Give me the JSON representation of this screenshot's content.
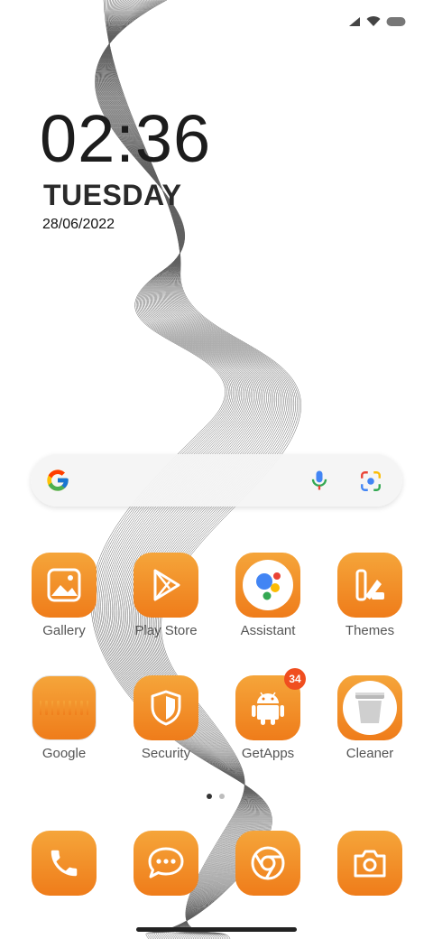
{
  "lockscreen": {
    "time": "02:36",
    "day": "TUESDAY",
    "date": "28/06/2022"
  },
  "status_bar": {
    "icons": [
      "signal-icon",
      "wifi-icon",
      "battery-icon"
    ]
  },
  "search_widget": {
    "icons": [
      "google-logo-icon",
      "microphone-icon",
      "google-lens-icon"
    ]
  },
  "apps_row1": [
    {
      "label": "Gallery",
      "icon": "gallery-icon"
    },
    {
      "label": "Play Store",
      "icon": "play-store-icon"
    },
    {
      "label": "Assistant",
      "icon": "assistant-icon"
    },
    {
      "label": "Themes",
      "icon": "themes-icon"
    }
  ],
  "apps_row2": [
    {
      "label": "Google",
      "icon": "google-folder-icon"
    },
    {
      "label": "Security",
      "icon": "security-shield-icon"
    },
    {
      "label": "GetApps",
      "icon": "android-icon",
      "badge": "34"
    },
    {
      "label": "Cleaner",
      "icon": "trash-icon"
    }
  ],
  "dock": [
    {
      "icon": "phone-icon"
    },
    {
      "icon": "messages-icon"
    },
    {
      "icon": "chrome-icon"
    },
    {
      "icon": "camera-icon"
    }
  ],
  "colors": {
    "app_gradient_top": "#f5a53a",
    "app_gradient_bottom": "#ef7c1a",
    "badge": "#f04e1f"
  },
  "page_indicator": {
    "count": 2,
    "active": 0
  }
}
